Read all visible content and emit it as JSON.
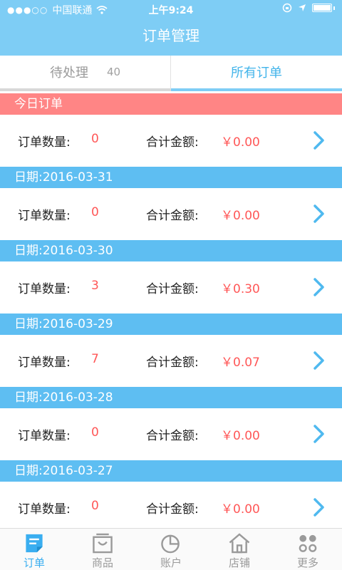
{
  "status_bar": {
    "signal": "●●●○○",
    "carrier": "中国联通",
    "time": "上午9:24"
  },
  "nav": {
    "title": "订单管理"
  },
  "tabs": {
    "pending_label": "待处理",
    "pending_count": "40",
    "all_label": "所有订单"
  },
  "labels": {
    "order_count": "订单数量:",
    "total_amount": "合计金额:"
  },
  "sections": [
    {
      "header": "今日订单",
      "count": "0",
      "amount": "￥0.00"
    },
    {
      "header": "日期:2016-03-31",
      "count": "0",
      "amount": "￥0.00"
    },
    {
      "header": "日期:2016-03-30",
      "count": "3",
      "amount": "￥0.30"
    },
    {
      "header": "日期:2016-03-29",
      "count": "7",
      "amount": "￥0.07"
    },
    {
      "header": "日期:2016-03-28",
      "count": "0",
      "amount": "￥0.00"
    },
    {
      "header": "日期:2016-03-27",
      "count": "0",
      "amount": "￥0.00"
    }
  ],
  "tabbar": [
    {
      "label": "订单",
      "icon": "orders-icon"
    },
    {
      "label": "商品",
      "icon": "products-icon"
    },
    {
      "label": "账户",
      "icon": "account-pie-icon"
    },
    {
      "label": "店铺",
      "icon": "store-house-icon"
    },
    {
      "label": "更多",
      "icon": "more-dots-icon"
    }
  ],
  "colors": {
    "nav_blue": "#7ecdf5",
    "date_header_blue": "#5ebef2",
    "today_header_red": "#ff8585",
    "value_red": "#ff5757",
    "active_blue": "#3aaef0"
  }
}
